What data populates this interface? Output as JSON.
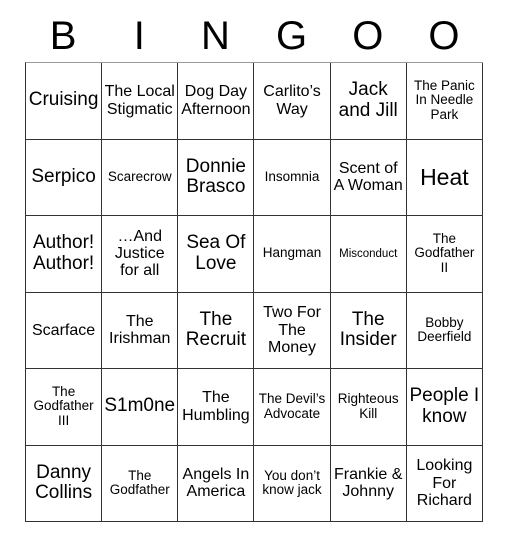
{
  "card": {
    "type": "bingo-card",
    "columns": 6,
    "rows": 6,
    "header": {
      "letters": [
        "B",
        "I",
        "N",
        "G",
        "O",
        "O"
      ]
    },
    "grid": [
      [
        {
          "label": "Cruising",
          "size": "lg"
        },
        {
          "label": "The Local Stigmatic",
          "size": "md"
        },
        {
          "label": "Dog Day Afternoon",
          "size": "md"
        },
        {
          "label": "Carlito’s Way",
          "size": "md"
        },
        {
          "label": "Jack and Jill",
          "size": "lg"
        },
        {
          "label": "The Panic In Needle Park",
          "size": "sm"
        }
      ],
      [
        {
          "label": "Serpico",
          "size": "lg"
        },
        {
          "label": "Scarecrow",
          "size": "sm"
        },
        {
          "label": "Donnie Brasco",
          "size": "lg"
        },
        {
          "label": "Insomnia",
          "size": "sm"
        },
        {
          "label": "Scent of A Woman",
          "size": "md"
        },
        {
          "label": "Heat",
          "size": "xl"
        }
      ],
      [
        {
          "label": "Author! Author!",
          "size": "lg"
        },
        {
          "label": "…And Justice for all",
          "size": "md"
        },
        {
          "label": "Sea Of Love",
          "size": "lg"
        },
        {
          "label": "Hangman",
          "size": "sm"
        },
        {
          "label": "Misconduct",
          "size": "xs"
        },
        {
          "label": "The Godfather II",
          "size": "sm"
        }
      ],
      [
        {
          "label": "Scarface",
          "size": "md"
        },
        {
          "label": "The Irishman",
          "size": "md"
        },
        {
          "label": "The Recruit",
          "size": "lg"
        },
        {
          "label": "Two For The Money",
          "size": "md"
        },
        {
          "label": "The Insider",
          "size": "lg"
        },
        {
          "label": "Bobby Deerfield",
          "size": "sm"
        }
      ],
      [
        {
          "label": "The Godfather III",
          "size": "sm"
        },
        {
          "label": "S1m0ne",
          "size": "lg"
        },
        {
          "label": "The Humbling",
          "size": "md"
        },
        {
          "label": "The Devil’s Advocate",
          "size": "sm"
        },
        {
          "label": "Righteous Kill",
          "size": "sm"
        },
        {
          "label": "People I know",
          "size": "lg"
        }
      ],
      [
        {
          "label": "Danny Collins",
          "size": "lg"
        },
        {
          "label": "The Godfather",
          "size": "sm"
        },
        {
          "label": "Angels In America",
          "size": "md"
        },
        {
          "label": "You don’t know jack",
          "size": "sm"
        },
        {
          "label": "Frankie & Johnny",
          "size": "md"
        },
        {
          "label": "Looking For Richard",
          "size": "md"
        }
      ]
    ]
  }
}
